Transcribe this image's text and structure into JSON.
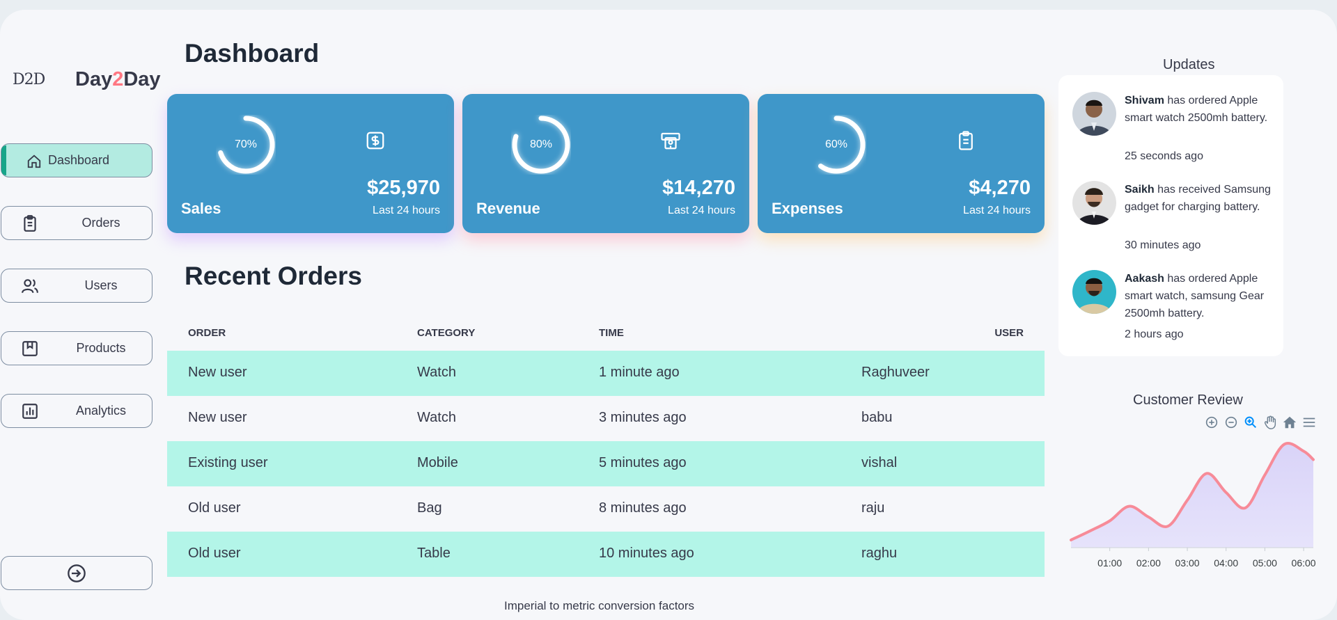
{
  "brand": {
    "mark": "D2D",
    "name_a": "Day",
    "name_b": "2",
    "name_c": "Day"
  },
  "nav": [
    {
      "label": "Dashboard",
      "icon": "home-icon",
      "active": true
    },
    {
      "label": "Orders",
      "icon": "clipboard-icon"
    },
    {
      "label": "Users",
      "icon": "users-icon"
    },
    {
      "label": "Products",
      "icon": "bookmark-icon"
    },
    {
      "label": "Analytics",
      "icon": "bar-chart-icon"
    }
  ],
  "logout_icon": "logout-icon",
  "page_title": "Dashboard",
  "cards": [
    {
      "label": "Sales",
      "percent": 70,
      "percent_text": "70%",
      "value": "$25,970",
      "sub": "Last 24 hours",
      "icon": "dollar-icon"
    },
    {
      "label": "Revenue",
      "percent": 80,
      "percent_text": "80%",
      "value": "$14,270",
      "sub": "Last 24 hours",
      "icon": "cash-icon"
    },
    {
      "label": "Expenses",
      "percent": 60,
      "percent_text": "60%",
      "value": "$4,270",
      "sub": "Last 24 hours",
      "icon": "receipt-icon"
    }
  ],
  "orders": {
    "title": "Recent Orders",
    "headers": [
      "ORDER",
      "CATEGORY",
      "TIME",
      "USER"
    ],
    "rows": [
      [
        "New user",
        "Watch",
        "1 minute ago",
        "Raghuveer"
      ],
      [
        "New user",
        "Watch",
        "3 minutes ago",
        "babu"
      ],
      [
        "Existing user",
        "Mobile",
        "5 minutes ago",
        "vishal"
      ],
      [
        "Old user",
        "Bag",
        "8 minutes ago",
        "raju"
      ],
      [
        "Old user",
        "Table",
        "10 minutes ago",
        "raghu"
      ]
    ]
  },
  "footer": "Imperial to metric conversion factors",
  "updates": {
    "title": "Updates",
    "items": [
      {
        "name": "Shivam",
        "text": " has ordered Apple smart watch 2500mh battery.",
        "time": "25 seconds ago"
      },
      {
        "name": "Saikh",
        "text": " has received Samsung gadget for charging battery.",
        "time": "30 minutes ago"
      },
      {
        "name": "Aakash",
        "text": " has ordered Apple smart watch, samsung Gear 2500mh battery.",
        "time": "2 hours ago"
      }
    ]
  },
  "review": {
    "title": "Customer Review",
    "tools": [
      "zoom-in-icon",
      "zoom-out-icon",
      "magnifier-icon",
      "pan-hand-icon",
      "home-icon",
      "menu-icon"
    ]
  },
  "chart_data": {
    "type": "area",
    "title": "Customer Review",
    "x": [
      "00:00",
      "00:30",
      "01:00",
      "01:30",
      "02:00",
      "02:30",
      "03:00",
      "03:30",
      "04:00",
      "04:30",
      "05:00",
      "05:30",
      "06:00",
      "06:15"
    ],
    "x_ticks": [
      "01:00",
      "02:00",
      "03:00",
      "04:00",
      "05:00",
      "06:00"
    ],
    "series": [
      {
        "values": [
          10,
          22,
          35,
          54,
          40,
          28,
          62,
          97,
          72,
          52,
          95,
          135,
          126,
          115
        ]
      }
    ],
    "ylim": [
      0,
      150
    ],
    "colors": {
      "line": "#f78b98",
      "fill_top": "#d9d3f8",
      "fill_bottom": "#e6e3fb"
    }
  }
}
